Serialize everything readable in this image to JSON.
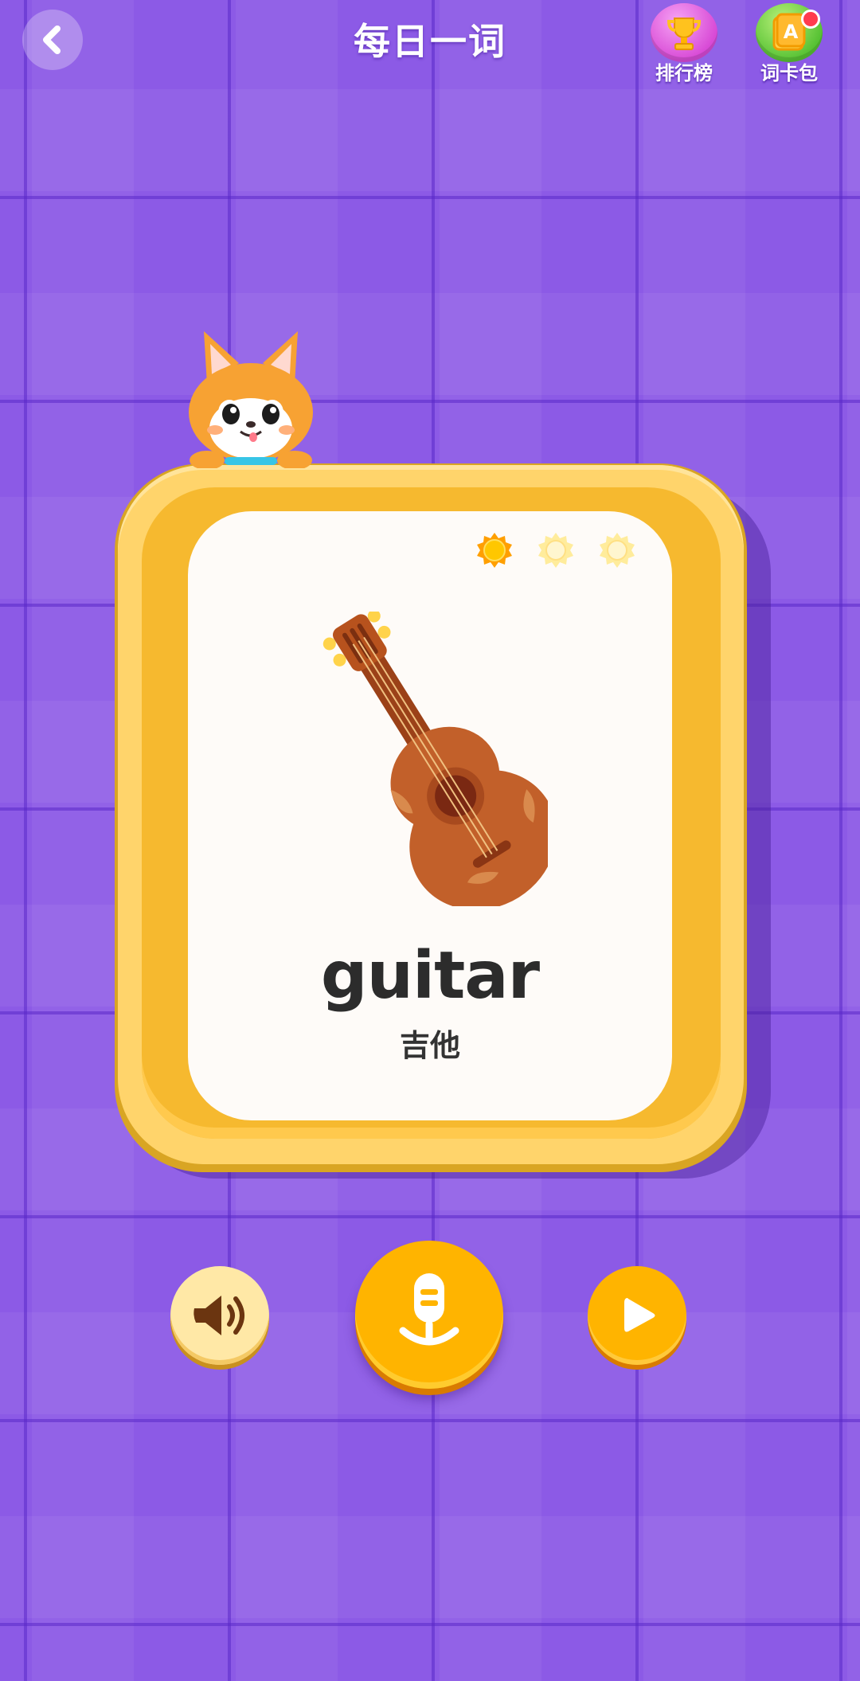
{
  "header": {
    "title": "每日一词",
    "back_icon": "chevron-left-icon",
    "leaderboard_label": "排行榜",
    "word_cards_label": "词卡包",
    "word_cards_has_notification": true
  },
  "card": {
    "word": "guitar",
    "translation": "吉他",
    "image": "guitar-illustration",
    "stars_total": 3,
    "stars_earned": 1
  },
  "controls": {
    "sound_icon": "speaker-icon",
    "mic_icon": "microphone-icon",
    "play_icon": "play-icon"
  },
  "colors": {
    "background": "#8c5ae6",
    "card_gold": "#f6b92f",
    "button_orange": "#ffb400"
  }
}
